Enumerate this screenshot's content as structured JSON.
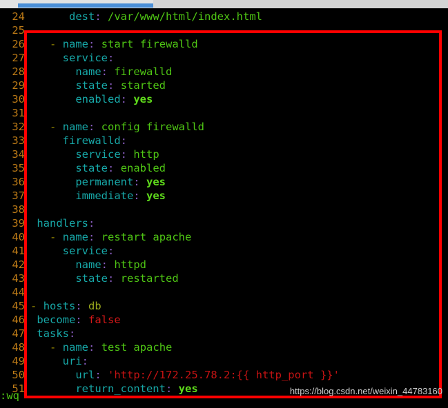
{
  "window": {
    "kind": "terminal-vim-editor",
    "background_color": "#000000",
    "chrome_color": "#d4d4d4",
    "scrollbar_color": "#4a8ed6"
  },
  "annotation": {
    "name": "red-highlight-rectangle",
    "color": "#ff0000",
    "border_width": 4
  },
  "watermark": {
    "text": "https://blog.csdn.net/weixin_44783160",
    "color": "#cfcfcf"
  },
  "command_line": {
    "text": ":wq",
    "color": "#4fc614"
  },
  "editor": {
    "first_visible_line": 24,
    "last_visible_line": 51,
    "lines": [
      {
        "n": "24",
        "tokens": [
          {
            "t": "      ",
            "c": "plain"
          },
          {
            "t": "dest",
            "c": "k"
          },
          {
            "t": ":",
            "c": "c"
          },
          {
            "t": " ",
            "c": "plain"
          },
          {
            "t": "/var/www/html/index.html",
            "c": "path"
          }
        ]
      },
      {
        "n": "25",
        "tokens": []
      },
      {
        "n": "26",
        "tokens": [
          {
            "t": "   ",
            "c": "plain"
          },
          {
            "t": "-",
            "c": "d"
          },
          {
            "t": " ",
            "c": "plain"
          },
          {
            "t": "name",
            "c": "k"
          },
          {
            "t": ":",
            "c": "c"
          },
          {
            "t": " ",
            "c": "plain"
          },
          {
            "t": "start firewalld",
            "c": "v"
          }
        ]
      },
      {
        "n": "27",
        "tokens": [
          {
            "t": "     ",
            "c": "plain"
          },
          {
            "t": "service",
            "c": "k"
          },
          {
            "t": ":",
            "c": "c"
          }
        ]
      },
      {
        "n": "28",
        "tokens": [
          {
            "t": "       ",
            "c": "plain"
          },
          {
            "t": "name",
            "c": "k"
          },
          {
            "t": ":",
            "c": "c"
          },
          {
            "t": " ",
            "c": "plain"
          },
          {
            "t": "firewalld",
            "c": "v"
          }
        ]
      },
      {
        "n": "29",
        "tokens": [
          {
            "t": "       ",
            "c": "plain"
          },
          {
            "t": "state",
            "c": "k"
          },
          {
            "t": ":",
            "c": "c"
          },
          {
            "t": " ",
            "c": "plain"
          },
          {
            "t": "started",
            "c": "v"
          }
        ]
      },
      {
        "n": "30",
        "tokens": [
          {
            "t": "       ",
            "c": "plain"
          },
          {
            "t": "enabled",
            "c": "k"
          },
          {
            "t": ":",
            "c": "c"
          },
          {
            "t": " ",
            "c": "plain"
          },
          {
            "t": "yes",
            "c": "vb"
          }
        ]
      },
      {
        "n": "31",
        "tokens": []
      },
      {
        "n": "32",
        "tokens": [
          {
            "t": "   ",
            "c": "plain"
          },
          {
            "t": "-",
            "c": "d"
          },
          {
            "t": " ",
            "c": "plain"
          },
          {
            "t": "name",
            "c": "k"
          },
          {
            "t": ":",
            "c": "c"
          },
          {
            "t": " ",
            "c": "plain"
          },
          {
            "t": "config firewalld",
            "c": "v"
          }
        ]
      },
      {
        "n": "33",
        "tokens": [
          {
            "t": "     ",
            "c": "plain"
          },
          {
            "t": "firewalld",
            "c": "k"
          },
          {
            "t": ":",
            "c": "c"
          }
        ]
      },
      {
        "n": "34",
        "tokens": [
          {
            "t": "       ",
            "c": "plain"
          },
          {
            "t": "service",
            "c": "k"
          },
          {
            "t": ":",
            "c": "c"
          },
          {
            "t": " ",
            "c": "plain"
          },
          {
            "t": "http",
            "c": "v"
          }
        ]
      },
      {
        "n": "35",
        "tokens": [
          {
            "t": "       ",
            "c": "plain"
          },
          {
            "t": "state",
            "c": "k"
          },
          {
            "t": ":",
            "c": "c"
          },
          {
            "t": " ",
            "c": "plain"
          },
          {
            "t": "enabled",
            "c": "v"
          }
        ]
      },
      {
        "n": "36",
        "tokens": [
          {
            "t": "       ",
            "c": "plain"
          },
          {
            "t": "permanent",
            "c": "k"
          },
          {
            "t": ":",
            "c": "c"
          },
          {
            "t": " ",
            "c": "plain"
          },
          {
            "t": "yes",
            "c": "vb"
          }
        ]
      },
      {
        "n": "37",
        "tokens": [
          {
            "t": "       ",
            "c": "plain"
          },
          {
            "t": "immediate",
            "c": "k"
          },
          {
            "t": ":",
            "c": "c"
          },
          {
            "t": " ",
            "c": "plain"
          },
          {
            "t": "yes",
            "c": "vb"
          }
        ]
      },
      {
        "n": "38",
        "tokens": []
      },
      {
        "n": "39",
        "tokens": [
          {
            "t": " ",
            "c": "plain"
          },
          {
            "t": "handlers",
            "c": "k"
          },
          {
            "t": ":",
            "c": "c"
          }
        ]
      },
      {
        "n": "40",
        "tokens": [
          {
            "t": "   ",
            "c": "plain"
          },
          {
            "t": "-",
            "c": "d"
          },
          {
            "t": " ",
            "c": "plain"
          },
          {
            "t": "name",
            "c": "k"
          },
          {
            "t": ":",
            "c": "c"
          },
          {
            "t": " ",
            "c": "plain"
          },
          {
            "t": "restart apache",
            "c": "v"
          }
        ]
      },
      {
        "n": "41",
        "tokens": [
          {
            "t": "     ",
            "c": "plain"
          },
          {
            "t": "service",
            "c": "k"
          },
          {
            "t": ":",
            "c": "c"
          }
        ]
      },
      {
        "n": "42",
        "tokens": [
          {
            "t": "       ",
            "c": "plain"
          },
          {
            "t": "name",
            "c": "k"
          },
          {
            "t": ":",
            "c": "c"
          },
          {
            "t": " ",
            "c": "plain"
          },
          {
            "t": "httpd",
            "c": "v"
          }
        ]
      },
      {
        "n": "43",
        "tokens": [
          {
            "t": "       ",
            "c": "plain"
          },
          {
            "t": "state",
            "c": "k"
          },
          {
            "t": ":",
            "c": "c"
          },
          {
            "t": " ",
            "c": "plain"
          },
          {
            "t": "restarted",
            "c": "v"
          }
        ]
      },
      {
        "n": "44",
        "tokens": []
      },
      {
        "n": "45",
        "tokens": [
          {
            "t": "-",
            "c": "d"
          },
          {
            "t": " ",
            "c": "plain"
          },
          {
            "t": "hosts",
            "c": "k"
          },
          {
            "t": ":",
            "c": "c"
          },
          {
            "t": " ",
            "c": "plain"
          },
          {
            "t": "db",
            "c": "olv"
          }
        ]
      },
      {
        "n": "46",
        "tokens": [
          {
            "t": " ",
            "c": "plain"
          },
          {
            "t": "become",
            "c": "k"
          },
          {
            "t": ":",
            "c": "c"
          },
          {
            "t": " ",
            "c": "plain"
          },
          {
            "t": "false",
            "c": "vf"
          }
        ]
      },
      {
        "n": "47",
        "tokens": [
          {
            "t": " ",
            "c": "plain"
          },
          {
            "t": "tasks",
            "c": "k"
          },
          {
            "t": ":",
            "c": "c"
          }
        ]
      },
      {
        "n": "48",
        "tokens": [
          {
            "t": "   ",
            "c": "plain"
          },
          {
            "t": "-",
            "c": "d"
          },
          {
            "t": " ",
            "c": "plain"
          },
          {
            "t": "name",
            "c": "k"
          },
          {
            "t": ":",
            "c": "c"
          },
          {
            "t": " ",
            "c": "plain"
          },
          {
            "t": "test apache",
            "c": "v"
          }
        ]
      },
      {
        "n": "49",
        "tokens": [
          {
            "t": "     ",
            "c": "plain"
          },
          {
            "t": "uri",
            "c": "k"
          },
          {
            "t": ":",
            "c": "c"
          }
        ]
      },
      {
        "n": "50",
        "tokens": [
          {
            "t": "       ",
            "c": "plain"
          },
          {
            "t": "url",
            "c": "k"
          },
          {
            "t": ":",
            "c": "c"
          },
          {
            "t": " ",
            "c": "plain"
          },
          {
            "t": "'http://172.25.78.2:{{ http_port }}'",
            "c": "str"
          }
        ]
      },
      {
        "n": "51",
        "tokens": [
          {
            "t": "       ",
            "c": "plain"
          },
          {
            "t": "return_content",
            "c": "k"
          },
          {
            "t": ":",
            "c": "c"
          },
          {
            "t": " ",
            "c": "plain"
          },
          {
            "t": "yes",
            "c": "vb"
          }
        ]
      }
    ]
  }
}
